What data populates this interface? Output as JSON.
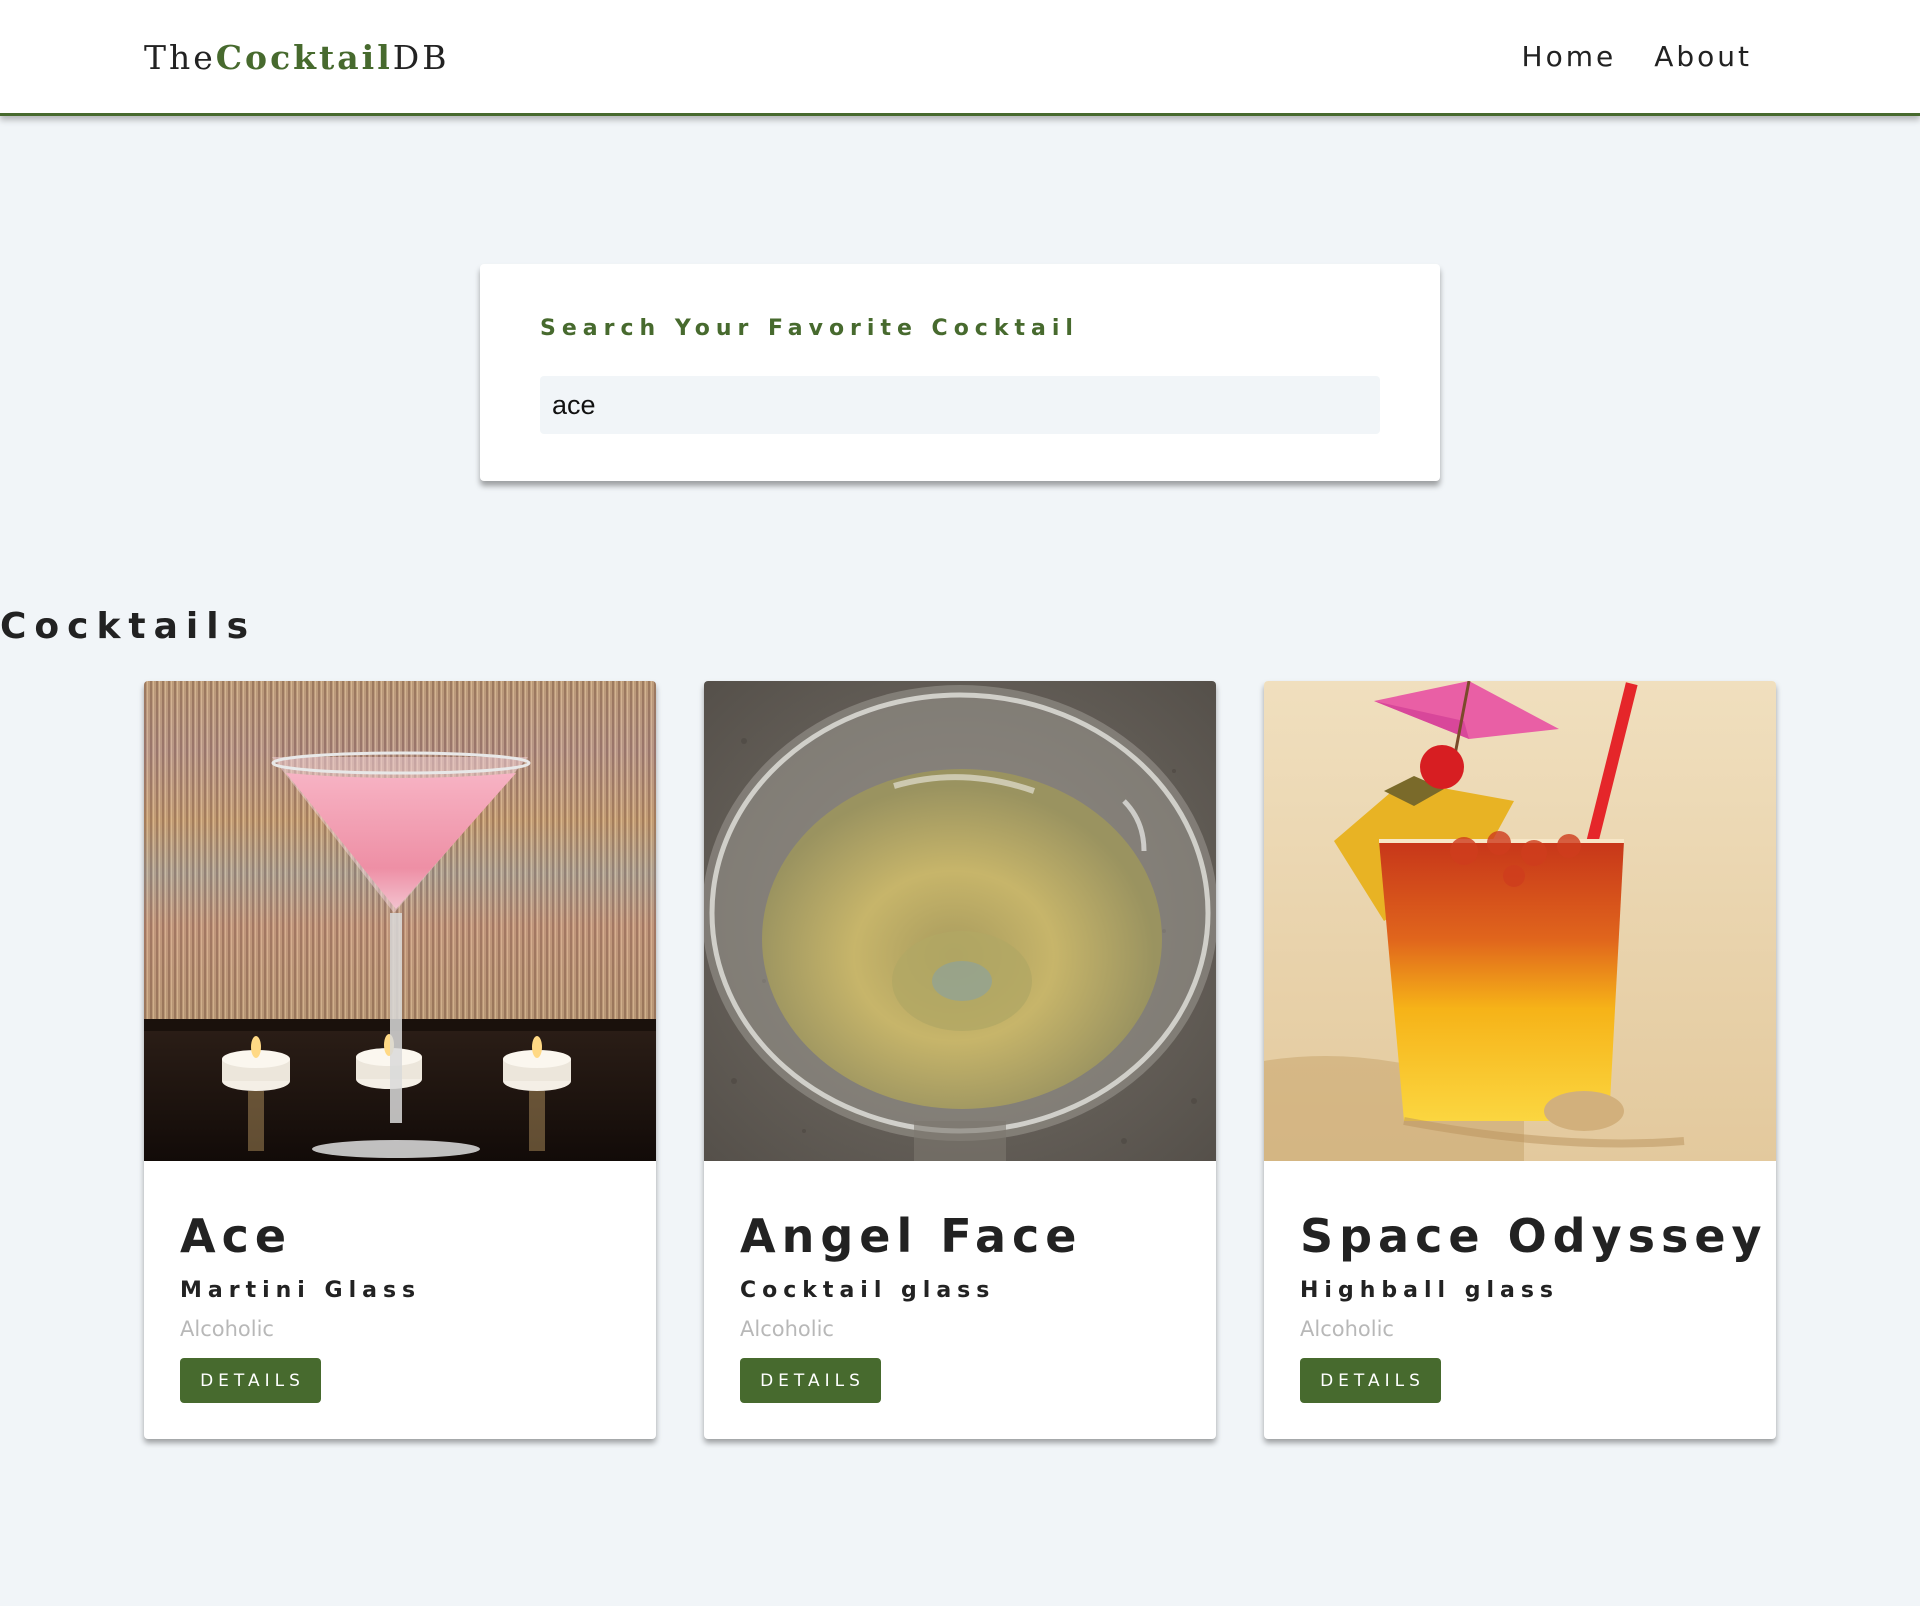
{
  "navbar": {
    "logo": {
      "prefix": "The",
      "accent": "Cocktail",
      "suffix": "DB"
    },
    "links": [
      {
        "label": "Home"
      },
      {
        "label": "About"
      }
    ]
  },
  "search": {
    "label": "Search Your Favorite Cocktail",
    "value": "ace"
  },
  "section": {
    "title": "Cocktails"
  },
  "cocktails": [
    {
      "name": "Ace",
      "glass": "Martini Glass",
      "type": "Alcoholic",
      "button": "DETAILS",
      "image": "pink-martini-photo"
    },
    {
      "name": "Angel Face",
      "glass": "Cocktail glass",
      "type": "Alcoholic",
      "button": "DETAILS",
      "image": "golden-cocktail-photo"
    },
    {
      "name": "Space Odyssey",
      "glass": "Highball glass",
      "type": "Alcoholic",
      "button": "DETAILS",
      "image": "tropical-drink-beach-photo"
    }
  ],
  "colors": {
    "accent": "#476a2e",
    "background": "#f1f5f8",
    "text": "#222222",
    "muted": "#b8b8b8"
  }
}
